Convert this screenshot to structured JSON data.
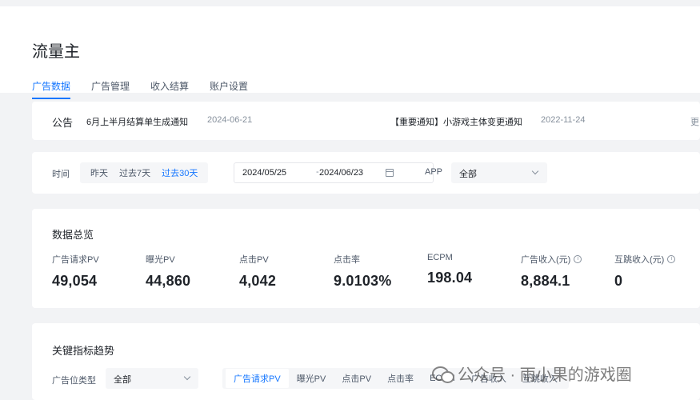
{
  "app": {
    "title": "流量主"
  },
  "nav": {
    "tabs": [
      {
        "label": "广告数据",
        "active": true
      },
      {
        "label": "广告管理"
      },
      {
        "label": "收入结算"
      },
      {
        "label": "账户设置"
      }
    ]
  },
  "notices": {
    "label": "公告",
    "items": [
      {
        "text": "6月上半月结算单生成通知",
        "date": "2024-06-21"
      },
      {
        "text": "【重要通知】小游戏主体变更通知",
        "date": "2022-11-24"
      }
    ],
    "more": "更"
  },
  "filters": {
    "time_label": "时间",
    "quick_ranges": [
      {
        "label": "昨天"
      },
      {
        "label": "过去7天"
      },
      {
        "label": "过去30天",
        "active": true
      }
    ],
    "date_start": "2024/05/25",
    "date_sep": "-",
    "date_end": "2024/06/23",
    "app_label": "APP",
    "app_value": "全部"
  },
  "overview": {
    "title": "数据总览",
    "metrics": [
      {
        "label": "广告请求PV",
        "value": "49,054"
      },
      {
        "label": "曝光PV",
        "value": "44,860"
      },
      {
        "label": "点击PV",
        "value": "4,042"
      },
      {
        "label": "点击率",
        "value": "9.0103%"
      },
      {
        "label": "ECPM",
        "value": "198.04"
      },
      {
        "label": "广告收入(元)",
        "value": "8,884.1",
        "info_icon": "info-circle-icon"
      },
      {
        "label": "互跳收入(元)",
        "value": "0",
        "info_icon": "info-circle-icon"
      }
    ]
  },
  "trend": {
    "title": "关键指标趋势",
    "type_label": "广告位类型",
    "type_value": "全部",
    "metric_tabs": [
      {
        "label": "广告请求PV",
        "active": true
      },
      {
        "label": "曝光PV"
      },
      {
        "label": "点击PV"
      },
      {
        "label": "点击率"
      },
      {
        "label": "ECPM"
      },
      {
        "label": "广告收入"
      },
      {
        "label": "互跳收入"
      }
    ]
  },
  "watermark": {
    "text": "公众号 · 雨小果的游戏圈",
    "icon": "wechat-icon"
  },
  "colors": {
    "accent": "#1677ff",
    "background": "#f2f3f5",
    "card": "#ffffff",
    "text": "#1f2329",
    "muted": "#86909c"
  }
}
